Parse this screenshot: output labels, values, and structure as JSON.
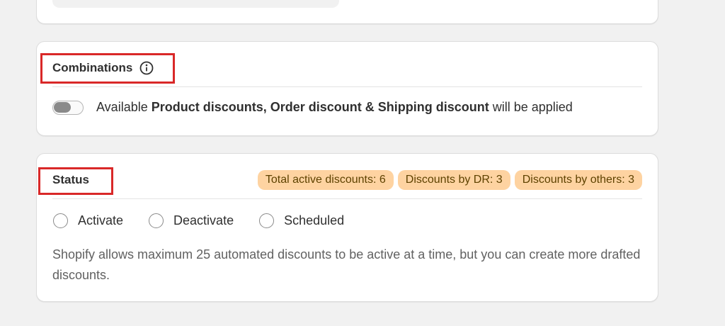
{
  "combinations": {
    "title": "Combinations",
    "info_icon": "info-circle-icon",
    "toggle_prefix": "Available ",
    "toggle_bold": "Product discounts, Order discount & Shipping discount",
    "toggle_suffix": " will be applied",
    "toggle_on": false
  },
  "status": {
    "title": "Status",
    "badges": [
      "Total active discounts: 6",
      "Discounts by DR: 3",
      "Discounts by others: 3"
    ],
    "options": [
      "Activate",
      "Deactivate",
      "Scheduled"
    ],
    "help_text": "Shopify allows maximum 25 automated discounts to be active at a time, but you can create more drafted discounts."
  },
  "colors": {
    "highlight_border": "#d92828",
    "badge_bg": "#fed3a1",
    "badge_text": "#5e4200",
    "page_bg": "#f1f1f1"
  }
}
